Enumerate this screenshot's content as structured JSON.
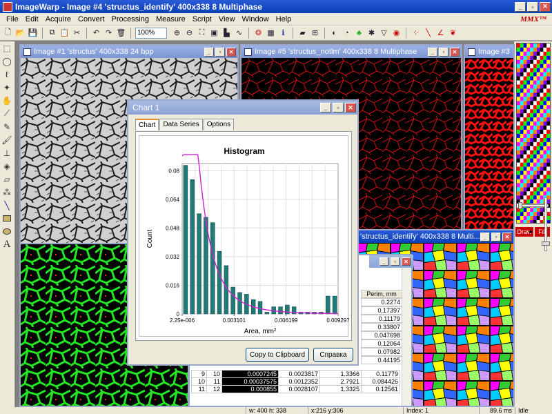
{
  "app": {
    "title": "ImageWarp - Image #4  'structus_identify'  400x338  8 Multiphase",
    "brand": "MMX™"
  },
  "menu": [
    "File",
    "Edit",
    "Acquire",
    "Convert",
    "Processing",
    "Measure",
    "Script",
    "View",
    "Window",
    "Help"
  ],
  "toolbar": {
    "zoom": "100%"
  },
  "windows": {
    "img1": {
      "title": "Image #1  'structus'  400x338  24 bpp"
    },
    "img5": {
      "title": "Image #5  'structus_notlm'  400x338  8 Multiphase"
    },
    "img3": {
      "title": "Image #3"
    },
    "img4": {
      "title": "'structus_identify'  400x338  8 Multi..."
    }
  },
  "dialog": {
    "title": "Chart 1",
    "tabs": [
      "Chart",
      "Data Series",
      "Options"
    ],
    "copy_button": "Copy to Clipboard",
    "help_button": "Справка"
  },
  "chart_data": {
    "type": "bar",
    "title": "Histogram",
    "xlabel": "Area, mm²",
    "ylabel": "Count",
    "ylim": [
      0,
      0.084
    ],
    "xlim": [
      2.25e-06,
      0.009297
    ],
    "xticks": [
      "2.25e-006",
      "0.003101",
      "0.006199",
      "0.009297"
    ],
    "yticks": [
      "0",
      "0.016",
      "0.032",
      "0.048",
      "0.064",
      "0.08"
    ],
    "bins": 23,
    "values": [
      0.083,
      0.075,
      0.056,
      0.054,
      0.051,
      0.035,
      0.027,
      0.015,
      0.012,
      0.011,
      0.008,
      0.007,
      0.001,
      0.004,
      0.004,
      0.005,
      0.004,
      0.001,
      0.001,
      0.001,
      0.001,
      0.01,
      0.01
    ],
    "fit_curve": {
      "color": "#d11fd1",
      "type": "lognormal"
    }
  },
  "table": {
    "header_perim": "Perim, mm",
    "perim_rows": [
      "0.2274",
      "0.17397",
      "0.11179",
      "0.33807",
      "0.047698",
      "0.12064",
      "0.07982",
      "0.44195"
    ],
    "rows": [
      {
        "a": "9",
        "b": "10",
        "c": "0.0007245",
        "d": "0.0023817",
        "e": "1.3366",
        "f": "0.11779"
      },
      {
        "a": "10",
        "b": "11",
        "c": "0.00037575",
        "d": "0.0012352",
        "e": "2.7921",
        "f": "0.084426"
      },
      {
        "a": "11",
        "b": "12",
        "c": "0.000855",
        "d": "0.0028107",
        "e": "1.3325",
        "f": "0.12561"
      }
    ]
  },
  "status": {
    "wh": "w: 400  h: 338",
    "xy": "x:216  y:306",
    "index": "Index:  1",
    "time": "89.6 ms",
    "state": "Idle"
  },
  "palette_colors": [
    "#ff0000",
    "#00ff00",
    "#0000ff",
    "#ffff00",
    "#ff00ff",
    "#00ffff",
    "#ff8000",
    "#8000ff",
    "#000000",
    "#ffffff"
  ]
}
